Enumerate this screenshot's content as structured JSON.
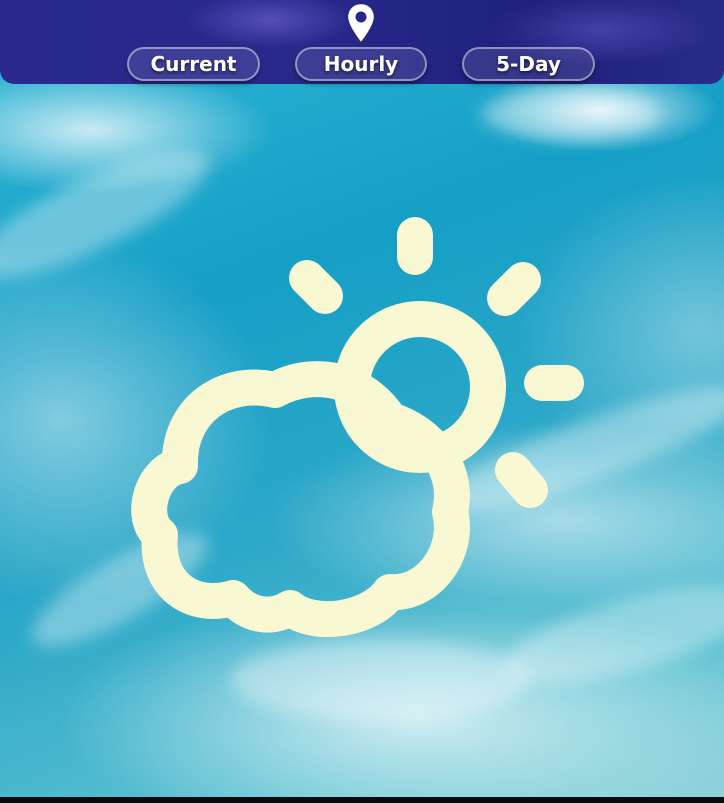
{
  "header": {
    "location_icon": "map-pin-icon",
    "tabs": [
      {
        "label": "Current",
        "active": false
      },
      {
        "label": "Hourly",
        "active": false
      },
      {
        "label": "5-Day",
        "active": false
      }
    ]
  },
  "main": {
    "condition_icon": "partly-cloudy-icon",
    "background": "sky-with-clouds"
  },
  "colors": {
    "header_bg": "#28288a",
    "icon_color": "#f8f8d2",
    "sky": "#1fa5cb",
    "tab_text": "#ffffff"
  }
}
